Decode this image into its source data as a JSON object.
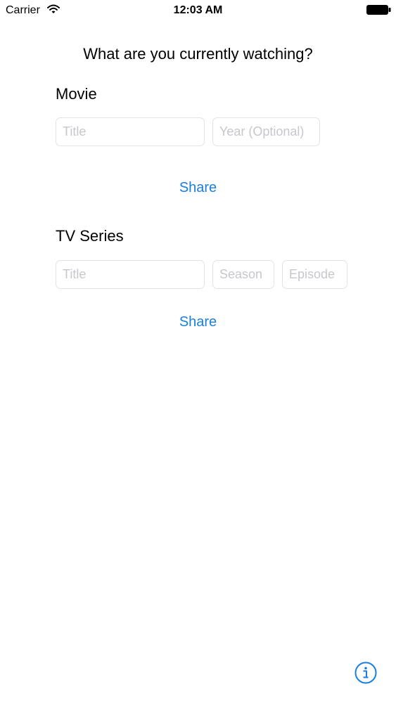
{
  "status_bar": {
    "carrier": "Carrier",
    "time": "12:03 AM",
    "wifi_icon": "wifi-icon",
    "battery_icon": "battery-icon"
  },
  "main": {
    "title": "What are you currently watching?"
  },
  "movie": {
    "heading": "Movie",
    "title_placeholder": "Title",
    "year_placeholder": "Year (Optional)",
    "share_label": "Share"
  },
  "tv_series": {
    "heading": "TV Series",
    "title_placeholder": "Title",
    "season_placeholder": "Season",
    "episode_placeholder": "Episode",
    "share_label": "Share"
  },
  "footer": {
    "info_icon": "info-icon"
  },
  "colors": {
    "accent": "#1a7fde",
    "placeholder": "#c7c7cd",
    "field_border": "#e3e3e6"
  }
}
